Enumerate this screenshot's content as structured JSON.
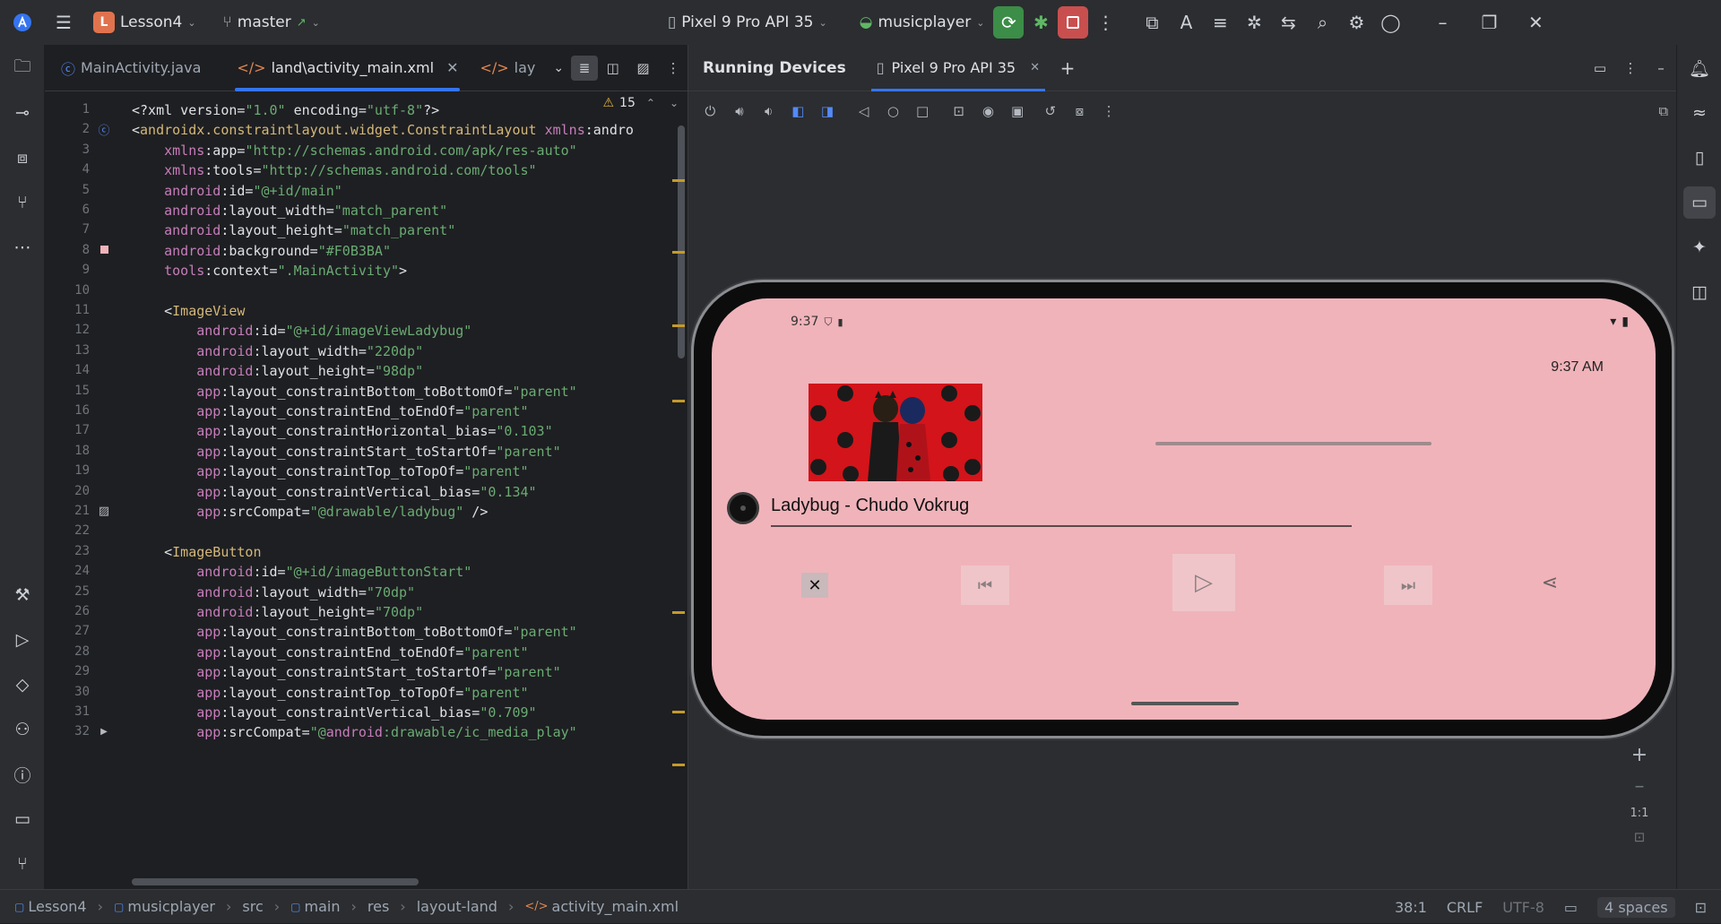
{
  "titlebar": {
    "project_initial": "L",
    "project_name": "Lesson4",
    "branch": "master",
    "device": "Pixel 9 Pro API 35",
    "run_config": "musicplayer"
  },
  "editor": {
    "tabs": [
      {
        "label": "MainActivity.java"
      },
      {
        "label": "land\\activity_main.xml"
      },
      {
        "label": "lay"
      }
    ],
    "warning_count": "15",
    "line_numbers": [
      "1",
      "2",
      "3",
      "4",
      "5",
      "6",
      "7",
      "8",
      "9",
      "10",
      "11",
      "12",
      "13",
      "14",
      "15",
      "16",
      "17",
      "18",
      "19",
      "20",
      "21",
      "22",
      "23",
      "24",
      "25",
      "26",
      "27",
      "28",
      "29",
      "30",
      "31",
      "32"
    ],
    "lines": [
      "<?xml version=\"1.0\" encoding=\"utf-8\"?>",
      "<androidx.constraintlayout.widget.ConstraintLayout xmlns:andro",
      "    xmlns:app=\"http://schemas.android.com/apk/res-auto\"",
      "    xmlns:tools=\"http://schemas.android.com/tools\"",
      "    android:id=\"@+id/main\"",
      "    android:layout_width=\"match_parent\"",
      "    android:layout_height=\"match_parent\"",
      "    android:background=\"#F0B3BA\"",
      "    tools:context=\".MainActivity\">",
      "",
      "    <ImageView",
      "        android:id=\"@+id/imageViewLadybug\"",
      "        android:layout_width=\"220dp\"",
      "        android:layout_height=\"98dp\"",
      "        app:layout_constraintBottom_toBottomOf=\"parent\"",
      "        app:layout_constraintEnd_toEndOf=\"parent\"",
      "        app:layout_constraintHorizontal_bias=\"0.103\"",
      "        app:layout_constraintStart_toStartOf=\"parent\"",
      "        app:layout_constraintTop_toTopOf=\"parent\"",
      "        app:layout_constraintVertical_bias=\"0.134\"",
      "        app:srcCompat=\"@drawable/ladybug\" />",
      "",
      "    <ImageButton",
      "        android:id=\"@+id/imageButtonStart\"",
      "        android:layout_width=\"70dp\"",
      "        android:layout_height=\"70dp\"",
      "        app:layout_constraintBottom_toBottomOf=\"parent\"",
      "        app:layout_constraintEnd_toEndOf=\"parent\"",
      "        app:layout_constraintStart_toStartOf=\"parent\"",
      "        app:layout_constraintTop_toTopOf=\"parent\"",
      "        app:layout_constraintVertical_bias=\"0.709\"",
      "        app:srcCompat=\"@android:drawable/ic_media_play\""
    ]
  },
  "devices": {
    "title": "Running Devices",
    "tab": "Pixel 9 Pro API 35",
    "zoom_label": "1:1"
  },
  "phone": {
    "status_time": "9:37",
    "clock": "9:37 AM",
    "song_title": "Ladybug - Chudo Vokrug",
    "background_color": "#F0B3BA"
  },
  "statusbar": {
    "breadcrumb": [
      "Lesson4",
      "musicplayer",
      "src",
      "main",
      "res",
      "layout-land",
      "activity_main.xml"
    ],
    "position": "38:1",
    "line_sep": "CRLF",
    "encoding": "UTF-8",
    "indent": "4 spaces"
  }
}
